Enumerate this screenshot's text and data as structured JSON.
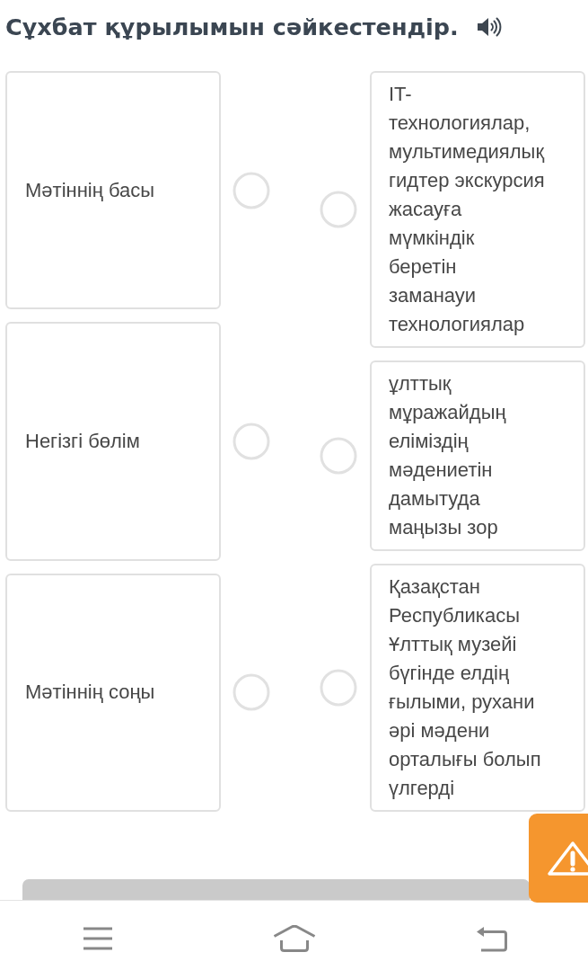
{
  "title": "Сұхбат құрылымын сәйкестендір.",
  "left_items": [
    {
      "label": "Мәтіннің басы"
    },
    {
      "label": "Негізгі бөлім"
    },
    {
      "label": "Мәтіннің соңы"
    }
  ],
  "right_items": [
    {
      "text": "IT-технологиялар,\nмультимедиялық\nгидтер экскурсия\nжасауға\nмүмкіндік\nберетін\nзаманауи\nтехнологиялар"
    },
    {
      "text": "ұлттық\nмұражайдың\nеліміздің\nмәдениетін\nдамытуда\nмаңызы зор"
    },
    {
      "text": "Қазақстан\nРеспубликасы\nҰлттық музейі\nбүгінде елдің\nғылыми, рухани\nәрі мәдени\nорталығы болып\nүлгерді"
    }
  ]
}
